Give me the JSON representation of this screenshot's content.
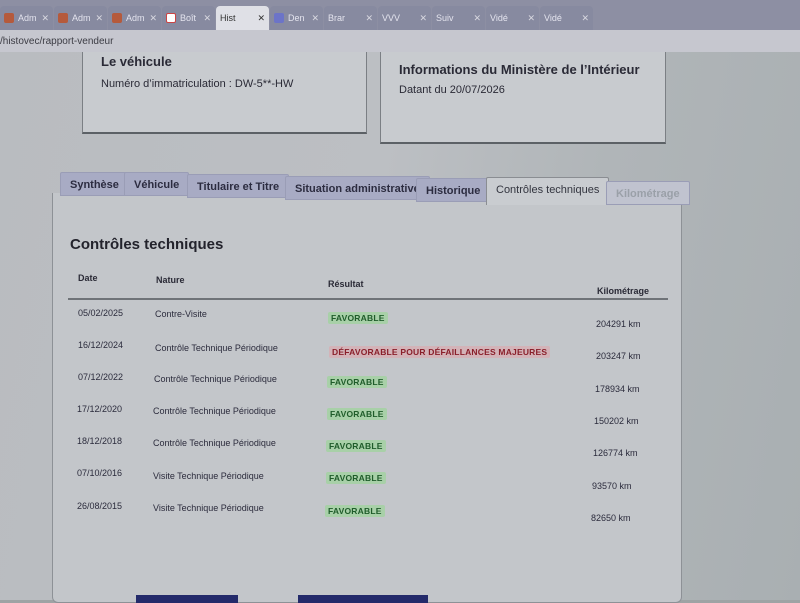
{
  "browser": {
    "tabs": [
      {
        "label": "Adm",
        "icon": "app-icon"
      },
      {
        "label": "Adm",
        "icon": "app-icon"
      },
      {
        "label": "Adm",
        "icon": "app-icon"
      },
      {
        "label": "Boît",
        "icon": "gmail-icon"
      },
      {
        "label": "Hist",
        "icon": "page-icon",
        "active": true
      },
      {
        "label": "Den",
        "icon": "doc-icon"
      },
      {
        "label": "Brar",
        "icon": "page-icon"
      },
      {
        "label": "VVV",
        "icon": "page-icon"
      },
      {
        "label": "Suiv",
        "icon": "page-icon"
      },
      {
        "label": "Vidé",
        "icon": "page-icon"
      },
      {
        "label": "Vidé",
        "icon": "page-icon"
      }
    ],
    "url": "/histovec/rapport-vendeur"
  },
  "vehicle_card": {
    "title": "Le véhicule",
    "registration_label": "Numéro d’immatriculation : DW-5**-HW"
  },
  "ministry_card": {
    "title": "Informations du Ministère de l’Intérieur",
    "date_label": "Datant du 20/07/2026"
  },
  "tabs": [
    {
      "label": "Synthèse"
    },
    {
      "label": "Véhicule"
    },
    {
      "label": "Titulaire et Titre"
    },
    {
      "label": "Situation administrative"
    },
    {
      "label": "Historique"
    },
    {
      "label": "Contrôles techniques",
      "active": true
    },
    {
      "label": "Kilométrage"
    }
  ],
  "section": {
    "title": "Contrôles techniques",
    "columns": {
      "date": "Date",
      "nature": "Nature",
      "result": "Résultat",
      "mileage": "Kilométrage"
    },
    "rows": [
      {
        "date": "05/02/2025",
        "nature": "Contre-Visite",
        "result": "FAVORABLE",
        "status": "ok",
        "mileage": "204291 km"
      },
      {
        "date": "16/12/2024",
        "nature": "Contrôle Technique Périodique",
        "result": "DÉFAVORABLE POUR DÉFAILLANCES MAJEURES",
        "status": "bad",
        "mileage": "203247 km"
      },
      {
        "date": "07/12/2022",
        "nature": "Contrôle Technique Périodique",
        "result": "FAVORABLE",
        "status": "ok",
        "mileage": "178934 km"
      },
      {
        "date": "17/12/2020",
        "nature": "Contrôle Technique Périodique",
        "result": "FAVORABLE",
        "status": "ok",
        "mileage": "150202 km"
      },
      {
        "date": "18/12/2018",
        "nature": "Contrôle Technique Périodique",
        "result": "FAVORABLE",
        "status": "ok",
        "mileage": "126774 km"
      },
      {
        "date": "07/10/2016",
        "nature": "Visite Technique Périodique",
        "result": "FAVORABLE",
        "status": "ok",
        "mileage": "93570 km"
      },
      {
        "date": "26/08/2015",
        "nature": "Visite Technique Périodique",
        "result": "FAVORABLE",
        "status": "ok",
        "mileage": "82650 km"
      }
    ]
  }
}
